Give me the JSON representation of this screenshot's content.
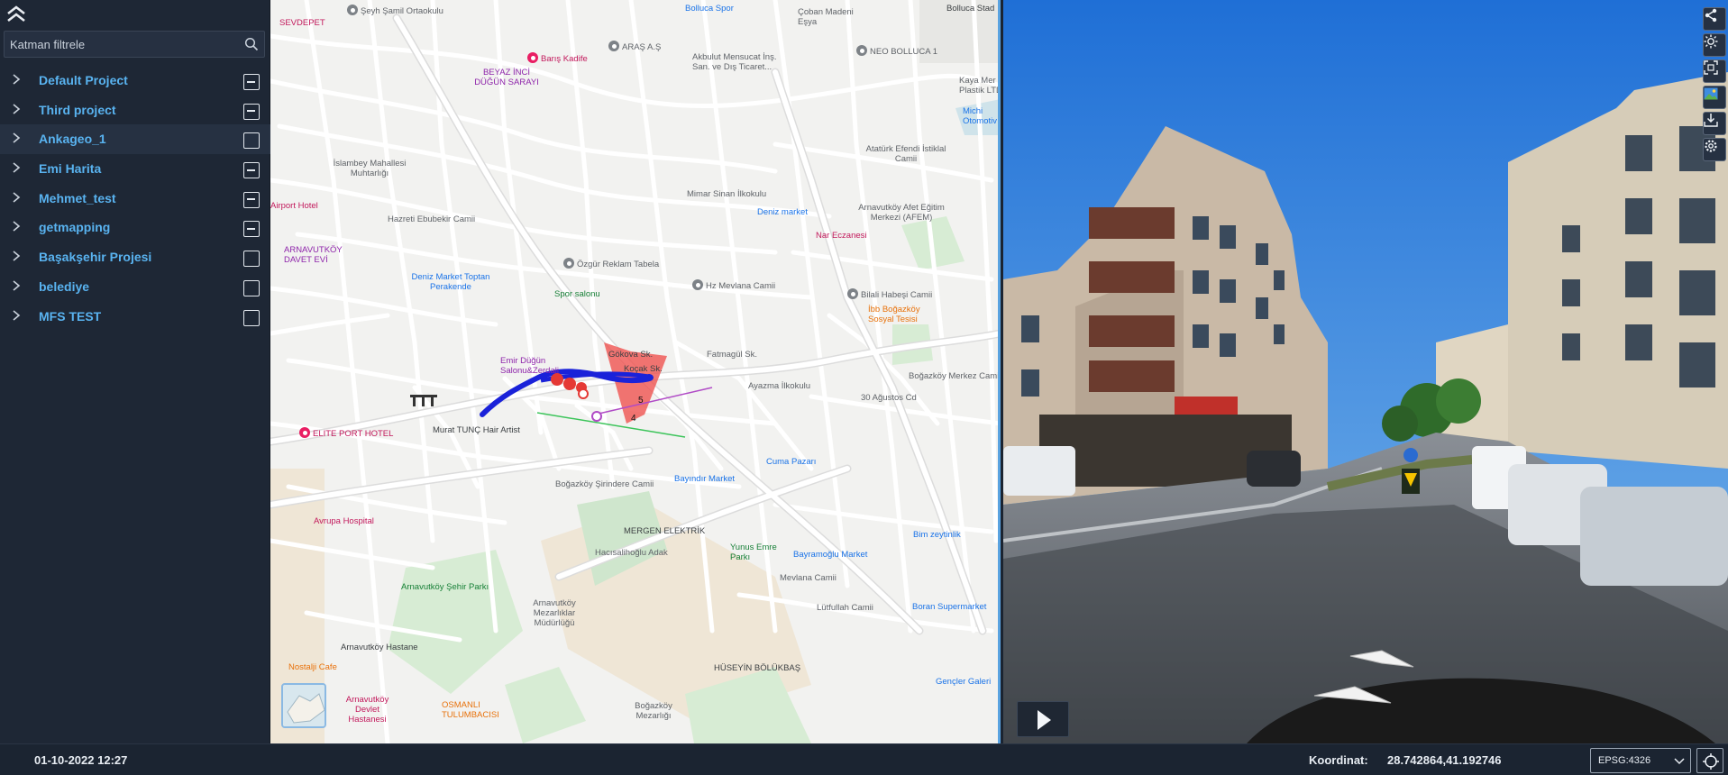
{
  "sidebar": {
    "collapse_icon": "double-chevron-up-icon",
    "filter_placeholder": "Katman filtrele",
    "layers": [
      {
        "label": "Default Project",
        "checked": "partial"
      },
      {
        "label": "Third project",
        "checked": "partial"
      },
      {
        "label": "Ankageo_1",
        "checked": "none"
      },
      {
        "label": "Emi Harita",
        "checked": "partial"
      },
      {
        "label": "Mehmet_test",
        "checked": "partial"
      },
      {
        "label": "getmapping",
        "checked": "partial"
      },
      {
        "label": "Başakşehir Projesi",
        "checked": "none"
      },
      {
        "label": "belediye",
        "checked": "none"
      },
      {
        "label": "MFS TEST",
        "checked": "none"
      }
    ]
  },
  "map": {
    "labels": [
      "SEVDEPET",
      "Şeyh Şamil Ortaokulu",
      "Barış Kadife",
      "BEYAZ İNCİ DÜĞÜN SARAYI",
      "ARAŞ A.Ş",
      "Akbulut Mensucat İnş. San. ve Dış Ticaret...",
      "NEO BOLLUCA 1",
      "Bolluca Stad",
      "Bolluca Spor",
      "Çoban Madeni Eşya",
      "Kaya Mer Plastik LTD",
      "Michi Otomotiv",
      "İslambey Mahallesi Muhtarlığı",
      "Hazreti Ebubekir Camii",
      "Mimar Sinan İlkokulu",
      "Deniz market",
      "Arnavutköy Afet Eğitim Merkezi (AFEM)",
      "Atatürk Efendi İstiklal Camii",
      "Nar Eczanesi",
      "Airport Hotel",
      "ARNAVUTKÖY DAVET EVİ",
      "Özgür Reklam Tabela",
      "Deniz Market Toptan Perakende",
      "Spor salonu",
      "Hz Mevlana Camii",
      "Bilali Habeşi Camii",
      "İbb Boğazköy Sosyal Tesisi",
      "Emir Düğün Salonu&Zerdali",
      "Ayazma İlkokulu",
      "Boğazköy Merkez Camii",
      "Murat TUNÇ Hair Artist",
      "ELITE PORT HOTEL",
      "Cuma Pazarı",
      "Boğazköy Şirindere Camii",
      "Bayındır Market",
      "MERGEN ELEKTRİK",
      "Avrupa Hospital",
      "Hacısalihoğlu Adak",
      "Yunus Emre Parkı",
      "Bayramoğlu Market",
      "Bim zeytinlik",
      "Mevlana Camii",
      "Boran Supermarket",
      "Arnavutköy Şehir Parkı",
      "Arnavutköy Mezarlıklar Müdürlüğü",
      "Lütfullah Camii",
      "Arnavutköy Hastane",
      "Nostalji Cafe",
      "HÜSEYİN BÖLÜKBAŞ",
      "Gençler Galeri",
      "Arnavutköy Devlet Hastanesi",
      "OSMANLI TULUMBACISI",
      "Boğazköy Mezarlığı",
      "Koçak Sk.",
      "Gökova Sk.",
      "30 Ağustos Cd",
      "Fatmagül Sk."
    ],
    "markers": [
      "1",
      "4",
      "5",
      "2",
      "3"
    ]
  },
  "streetview": {
    "play_icon": "play-icon",
    "tools": [
      "share-icon",
      "brightness-icon",
      "fullscreen-icon",
      "image-icon",
      "download-icon",
      "settings-icon"
    ]
  },
  "footer": {
    "datetime": "01-10-2022 12:27",
    "coord_label": "Koordinat:",
    "coord_value": "28.742864,41.192746",
    "epsg": "EPSG:4326"
  }
}
